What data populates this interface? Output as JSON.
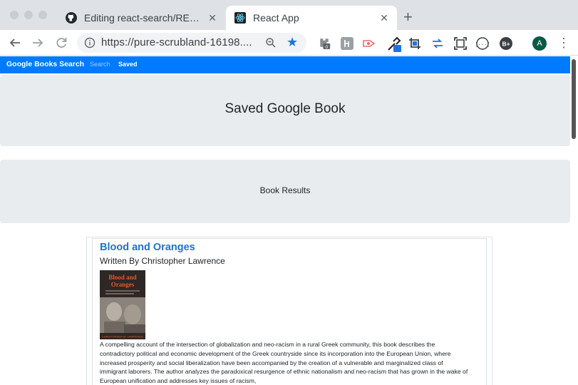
{
  "browser": {
    "tabs": [
      {
        "title": "Editing react-search/README.md",
        "favicon": "github-icon",
        "active": false
      },
      {
        "title": "React App",
        "favicon": "react-icon",
        "active": true
      }
    ],
    "close_glyph": "✕",
    "new_tab_glyph": "+",
    "url": "https://pure-scrubland-16198....",
    "extension_badge": "0",
    "profile_initial": "A",
    "ext_bplus_label": "B+",
    "ext_code_label": "{···}",
    "accent_color": "#1a73e8"
  },
  "app": {
    "brand": "Google Books Search",
    "nav": [
      {
        "label": "Search",
        "active": false
      },
      {
        "label": "Saved",
        "active": true
      }
    ],
    "nav_color": "#007bff",
    "header_title": "Saved Google Book",
    "results_title": "Book Results"
  },
  "book": {
    "title": "Blood and Oranges",
    "author_line": "Written By Christopher Lawrence",
    "cover_title_line1": "Blood and",
    "cover_title_line2": "Oranges",
    "cover_author": "CHRISTOPHER M. LAWRENCE",
    "description": "A compelling account of the intersection of globalization and neo-racism in a rural Greek community, this book describes the contradictory political and economic development of the Greek countryside since its incorporation into the European Union, where increased prosperity and social liberalization have been accompanied by the creation of a vulnerable and marginalized class of immigrant laborers. The author analyzes the paradoxical resurgence of ethnic nationalism and neo-racism that has grown in the wake of European unification and addresses key issues of racism,"
  }
}
